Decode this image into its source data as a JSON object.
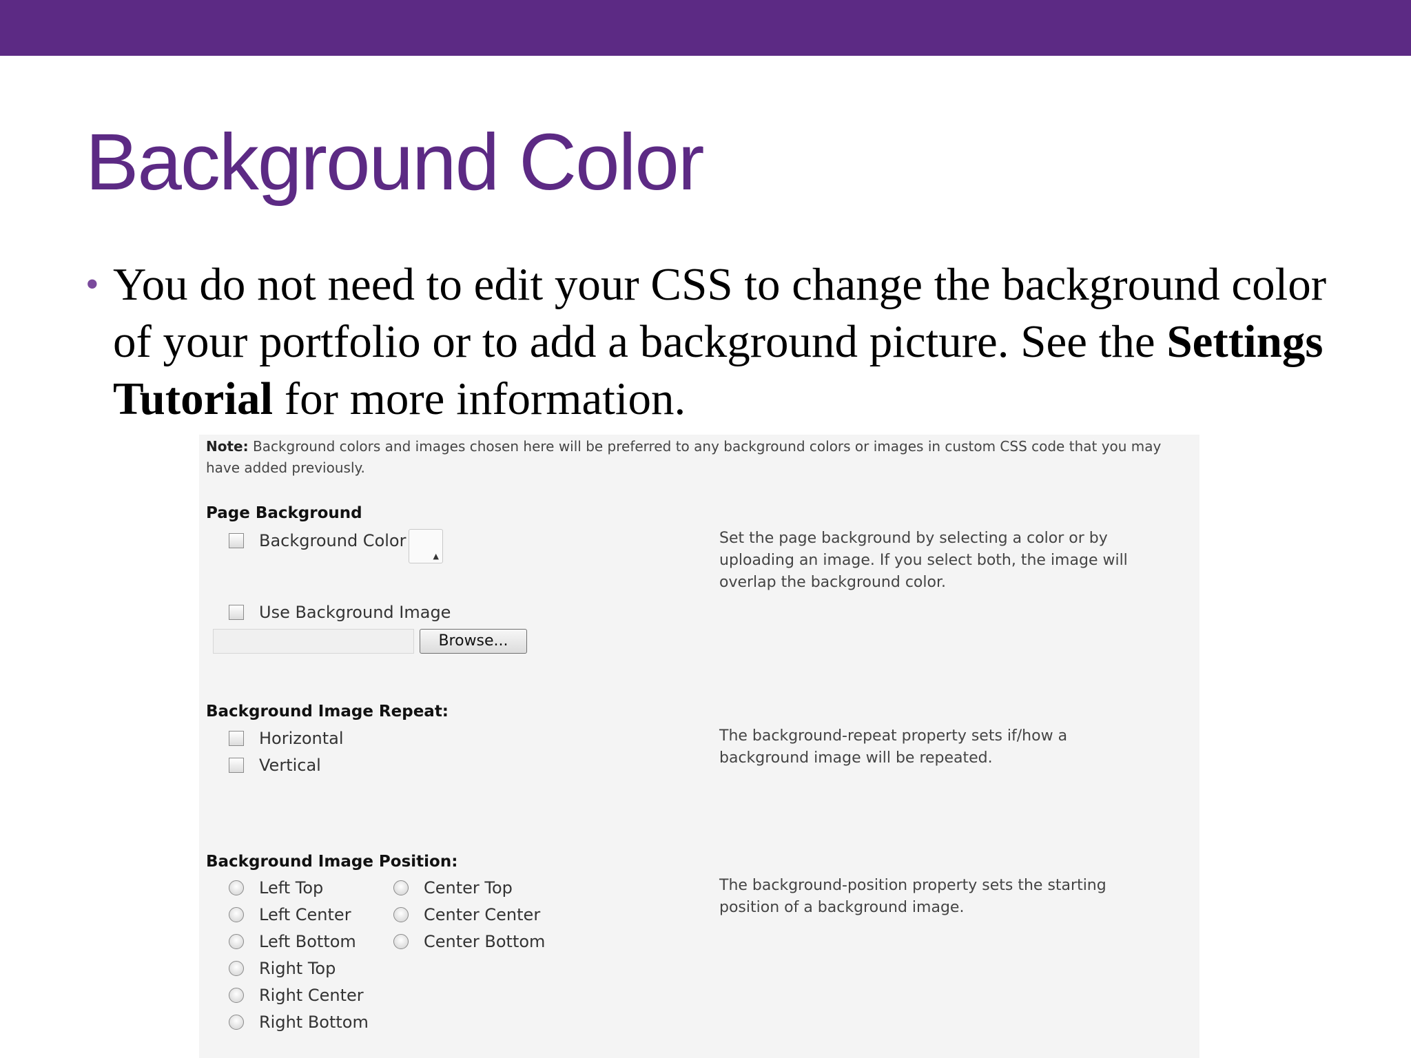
{
  "slide": {
    "title": "Background Color",
    "bullet": {
      "dot": "•",
      "text_before": "You do not need to edit your CSS to change the background color of your portfolio or to add a background picture. See the ",
      "bold": "Settings Tutorial",
      "text_after": " for more information."
    },
    "colors": {
      "accent": "#5c2a84"
    }
  },
  "screenshot": {
    "note": {
      "label": "Note:",
      "text": " Background colors and images chosen here will be preferred to any background colors or images in custom CSS code that you may have added previously."
    },
    "page_background": {
      "heading": "Page Background",
      "bg_color_label": "Background Color",
      "use_bg_image_label": "Use Background Image",
      "browse_label": "Browse...",
      "swatch_icon": "color-picker-arrow",
      "description": "Set the page background by selecting a color or by uploading an image. If you select both, the image will overlap the background color."
    },
    "repeat": {
      "heading": "Background Image Repeat:",
      "horizontal_label": "Horizontal",
      "vertical_label": "Vertical",
      "description": "The background-repeat property sets if/how a background image will be repeated."
    },
    "position": {
      "heading": "Background Image Position:",
      "left_column": [
        "Left Top",
        "Left Center",
        "Left Bottom",
        "Right Top",
        "Right Center",
        "Right Bottom"
      ],
      "center_column": [
        "Center Top",
        "Center Center",
        "Center Bottom"
      ],
      "description": "The background-position property sets the starting position of a background image."
    }
  }
}
